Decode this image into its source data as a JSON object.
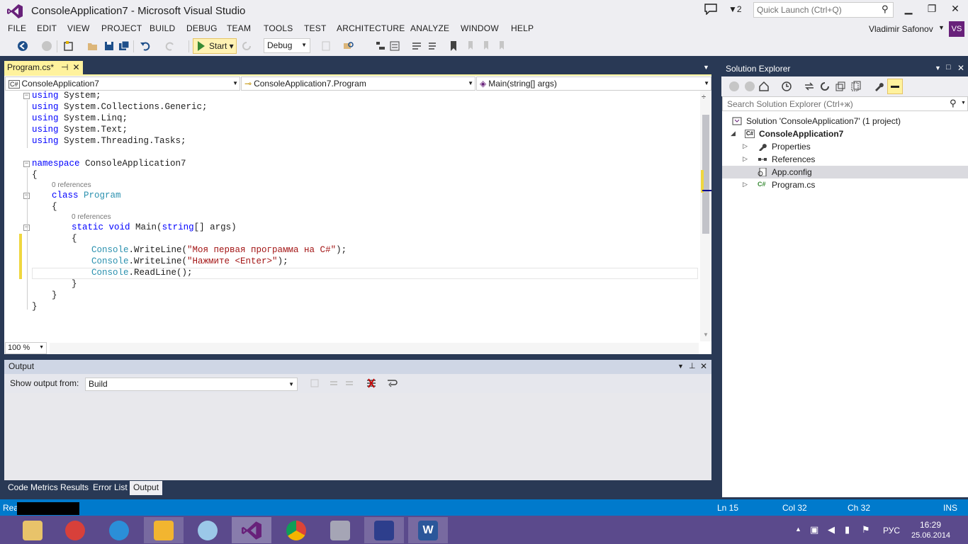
{
  "window": {
    "title": "ConsoleApplication7 - Microsoft Visual Studio",
    "notification_count": "2",
    "quick_launch_placeholder": "Quick Launch (Ctrl+Q)"
  },
  "menu": [
    "FILE",
    "EDIT",
    "VIEW",
    "PROJECT",
    "BUILD",
    "DEBUG",
    "TEAM",
    "TOOLS",
    "TEST",
    "ARCHITECTURE",
    "ANALYZE",
    "WINDOW",
    "HELP"
  ],
  "user": {
    "name": "Vladimir Safonov",
    "initials": "VS"
  },
  "toolbar": {
    "start_label": "Start",
    "configuration": "Debug"
  },
  "editor": {
    "tab_label": "Program.cs*",
    "nav": {
      "project": "ConsoleApplication7",
      "class": "ConsoleApplication7.Program",
      "member": "Main(string[] args)"
    },
    "codelens": "0 references",
    "code": {
      "l1": [
        "using",
        " System;"
      ],
      "l2": [
        "using",
        " System.Collections.Generic;"
      ],
      "l3": [
        "using",
        " System.Linq;"
      ],
      "l4": [
        "using",
        " System.Text;"
      ],
      "l5": [
        "using",
        " System.Threading.Tasks;"
      ],
      "l6": [
        "namespace",
        " ConsoleApplication7"
      ],
      "brace_open": "{",
      "brace_close": "}",
      "l8": [
        "class",
        " ",
        "Program"
      ],
      "l10": [
        "static",
        " ",
        "void",
        " Main(",
        "string",
        "[] args)"
      ],
      "l12": [
        "Console",
        ".WriteLine(",
        "\"Моя первая программа на C#\"",
        ");"
      ],
      "l13": [
        "Console",
        ".WriteLine(",
        "\"Нажмите <Enter>\"",
        ");"
      ],
      "l14": [
        "Console",
        ".ReadLine();"
      ]
    },
    "zoom": "100 %"
  },
  "output": {
    "title": "Output",
    "show_from_label": "Show output from:",
    "source": "Build",
    "tabs": [
      "Code Metrics Results",
      "Error List",
      "Output"
    ],
    "active_tab": "Output"
  },
  "solution_explorer": {
    "title": "Solution Explorer",
    "search_placeholder": "Search Solution Explorer (Ctrl+ж)",
    "items": [
      {
        "label": "Solution 'ConsoleApplication7' (1 project)",
        "icon": "solution-icon"
      },
      {
        "label": "ConsoleApplication7",
        "icon": "csharp-project-icon"
      },
      {
        "label": "Properties",
        "icon": "wrench-icon"
      },
      {
        "label": "References",
        "icon": "references-icon"
      },
      {
        "label": "App.config",
        "icon": "config-file-icon"
      },
      {
        "label": "Program.cs",
        "icon": "csharp-file-icon"
      }
    ],
    "selected": "App.config"
  },
  "status": {
    "ready": "Rea",
    "line": "Ln 15",
    "col": "Col 32",
    "ch": "Ch 32",
    "mode": "INS"
  },
  "taskbar": {
    "lang": "РУС",
    "time": "16:29",
    "date": "25.06.2014"
  },
  "colors": {
    "accent": "#007acc",
    "vs_purple": "#68217a",
    "dock_bg": "#293955",
    "tab_yellow": "#fff29d"
  }
}
